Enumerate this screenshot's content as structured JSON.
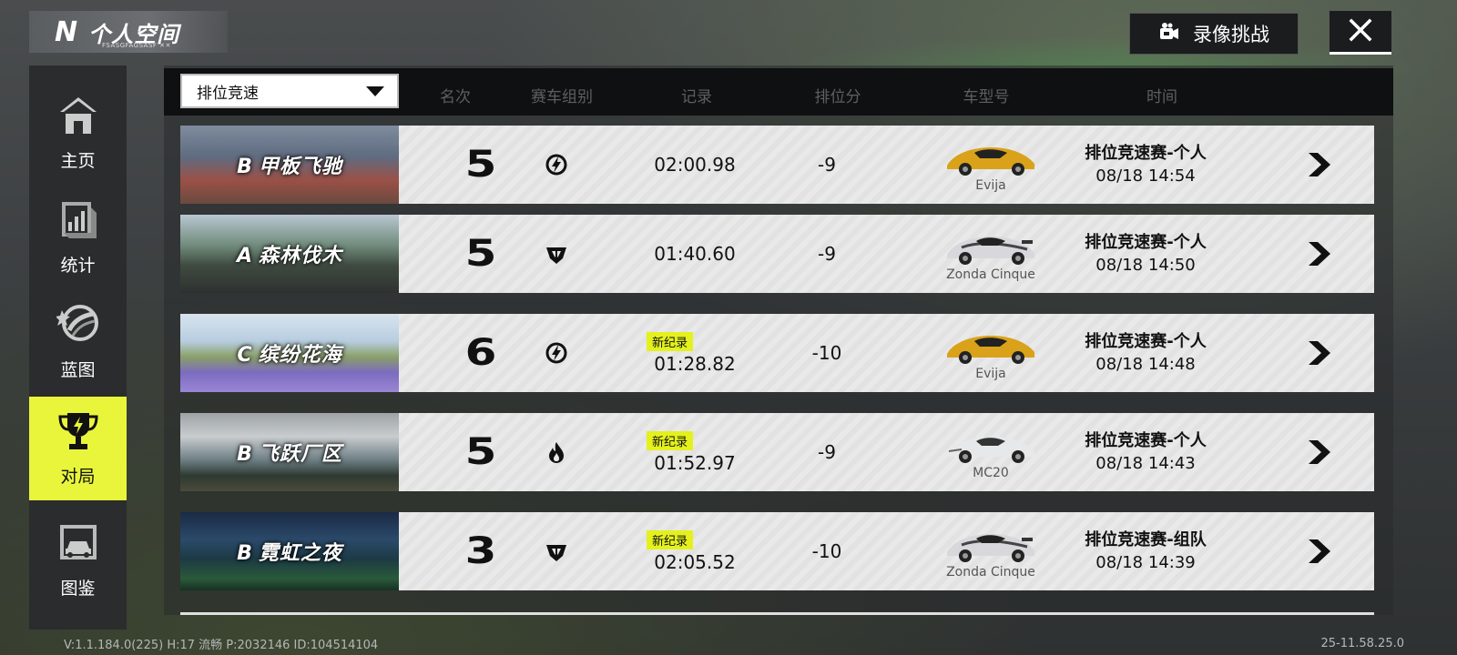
{
  "header": {
    "logo": "N",
    "title": "个人空间",
    "subtitle": "FSASGFAGSASF ✕✕",
    "record_button": "录像挑战"
  },
  "sidebar": {
    "items": [
      {
        "label": "主页",
        "icon": "home-icon",
        "active": false
      },
      {
        "label": "统计",
        "icon": "stats-icon",
        "active": false
      },
      {
        "label": "蓝图",
        "icon": "blueprint-icon",
        "active": false
      },
      {
        "label": "对局",
        "icon": "trophy-icon",
        "active": true
      },
      {
        "label": "图鉴",
        "icon": "garage-icon",
        "active": false
      }
    ]
  },
  "filter": {
    "selected": "排位竞速"
  },
  "columns": [
    "名次",
    "赛车组别",
    "记录",
    "排位分",
    "车型号",
    "时间"
  ],
  "rows": [
    {
      "grade": "B",
      "track": "甲板飞驰",
      "rank": "5",
      "group_icon": "lightning-badge-icon",
      "new_record": "",
      "time": "02:00.98",
      "score": "-9",
      "car": "Evija",
      "car_color": "#d9a21a",
      "mode": "排位竞速赛-个人",
      "date": "08/18  14:54"
    },
    {
      "grade": "A",
      "track": "森林伐木",
      "rank": "5",
      "group_icon": "shield-wings-icon",
      "new_record": "",
      "time": "01:40.60",
      "score": "-9",
      "car": "Zonda Cinque",
      "car_color": "#d8d8dc",
      "mode": "排位竞速赛-个人",
      "date": "08/18  14:50"
    },
    {
      "grade": "C",
      "track": "缤纷花海",
      "rank": "6",
      "group_icon": "lightning-badge-icon",
      "new_record": "新纪录",
      "time": "01:28.82",
      "score": "-10",
      "car": "Evija",
      "car_color": "#d9a21a",
      "mode": "排位竞速赛-个人",
      "date": "08/18  14:48"
    },
    {
      "grade": "B",
      "track": "飞跃厂区",
      "rank": "5",
      "group_icon": "flame-icon",
      "new_record": "新纪录",
      "time": "01:52.97",
      "score": "-9",
      "car": "MC20",
      "car_color": "#e6e8ea",
      "mode": "排位竞速赛-个人",
      "date": "08/18  14:43"
    },
    {
      "grade": "B",
      "track": "霓虹之夜",
      "rank": "3",
      "group_icon": "shield-wings-icon",
      "new_record": "新纪录",
      "time": "02:05.52",
      "score": "-10",
      "car": "Zonda Cinque",
      "car_color": "#d8d8dc",
      "mode": "排位竞速赛-组队",
      "date": "08/18  14:39"
    }
  ],
  "footer": {
    "version": "V:1.1.184.0(225) H:17 流畅 P:2032146 ID:104514104",
    "build": "25-11.58.25.0"
  }
}
